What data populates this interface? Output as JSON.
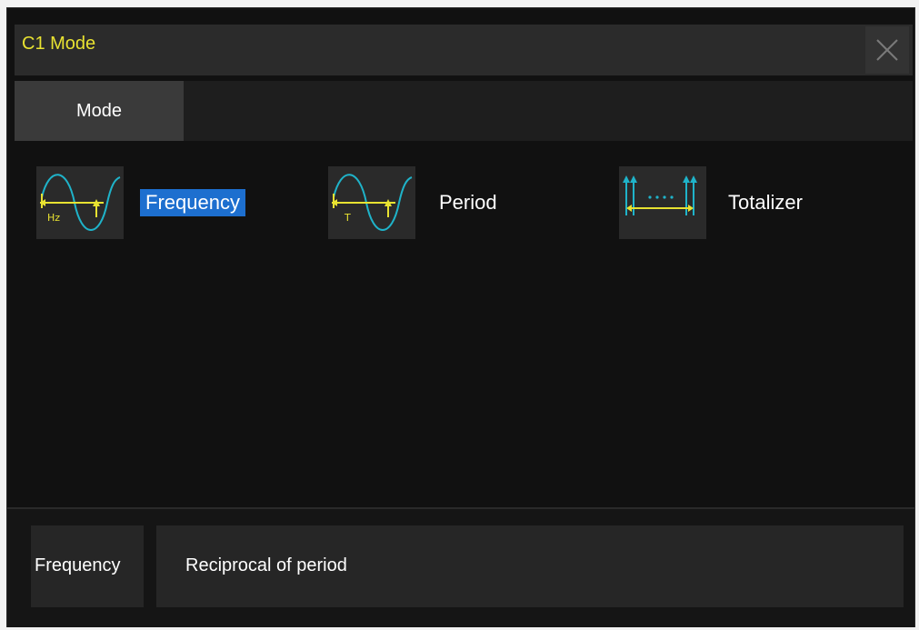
{
  "dialog": {
    "title": "C1 Mode",
    "close_icon": "close-icon"
  },
  "tabs": [
    {
      "label": "Mode",
      "active": true
    }
  ],
  "options": [
    {
      "label": "Frequency",
      "icon": "frequency-wave-icon",
      "icon_text": "Hz",
      "selected": true
    },
    {
      "label": "Period",
      "icon": "period-wave-icon",
      "icon_text": "T",
      "selected": false
    },
    {
      "label": "Totalizer",
      "icon": "totalizer-pulse-icon",
      "selected": false
    }
  ],
  "description": {
    "key": "Frequency",
    "text": "Reciprocal of period"
  },
  "colors": {
    "title": "#e8e231",
    "selection": "#1d6fcf",
    "wave": "#1fb3c9",
    "marker": "#e8e231"
  }
}
